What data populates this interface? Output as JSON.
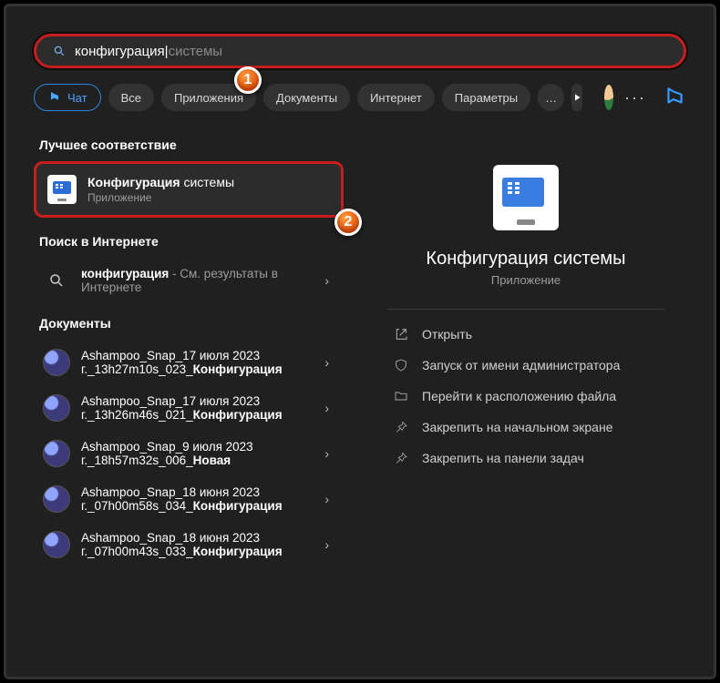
{
  "search": {
    "typed": "конфигурация|",
    "suggestion": "системы"
  },
  "filters": {
    "chat": "Чат",
    "all": "Все",
    "apps": "Приложения",
    "docs": "Документы",
    "internet": "Интернет",
    "settings": "Параметры"
  },
  "badges": {
    "one": "1",
    "two": "2"
  },
  "sections": {
    "best": "Лучшее соответствие",
    "web": "Поиск в Интернете",
    "documents": "Документы"
  },
  "best_match": {
    "title_bold": "Конфигурация",
    "title_rest": " системы",
    "subtitle": "Приложение"
  },
  "web_result": {
    "term": "конфигурация",
    "rest": " - См. результаты в Интернете"
  },
  "documents": [
    {
      "line1": "Ashampoo_Snap_17 июля 2023",
      "line2_pre": "г._13h27m10s_023_",
      "line2_bold": "Конфигурация"
    },
    {
      "line1": "Ashampoo_Snap_17 июля 2023",
      "line2_pre": "г._13h26m46s_021_",
      "line2_bold": "Конфигурация"
    },
    {
      "line1": "Ashampoo_Snap_9 июля 2023",
      "line2_pre": "г._18h57m32s_006_",
      "line2_bold": "Новая"
    },
    {
      "line1": "Ashampoo_Snap_18 июня 2023",
      "line2_pre": "г._07h00m58s_034_",
      "line2_bold": "Конфигурация"
    },
    {
      "line1": "Ashampoo_Snap_18 июня 2023",
      "line2_pre": "г._07h00m43s_033_",
      "line2_bold": "Конфигурация"
    }
  ],
  "preview": {
    "title": "Конфигурация системы",
    "type": "Приложение"
  },
  "actions": {
    "open": "Открыть",
    "admin": "Запуск от имени администратора",
    "location": "Перейти к расположению файла",
    "pin_start": "Закрепить на начальном экране",
    "pin_taskbar": "Закрепить на панели задач"
  }
}
